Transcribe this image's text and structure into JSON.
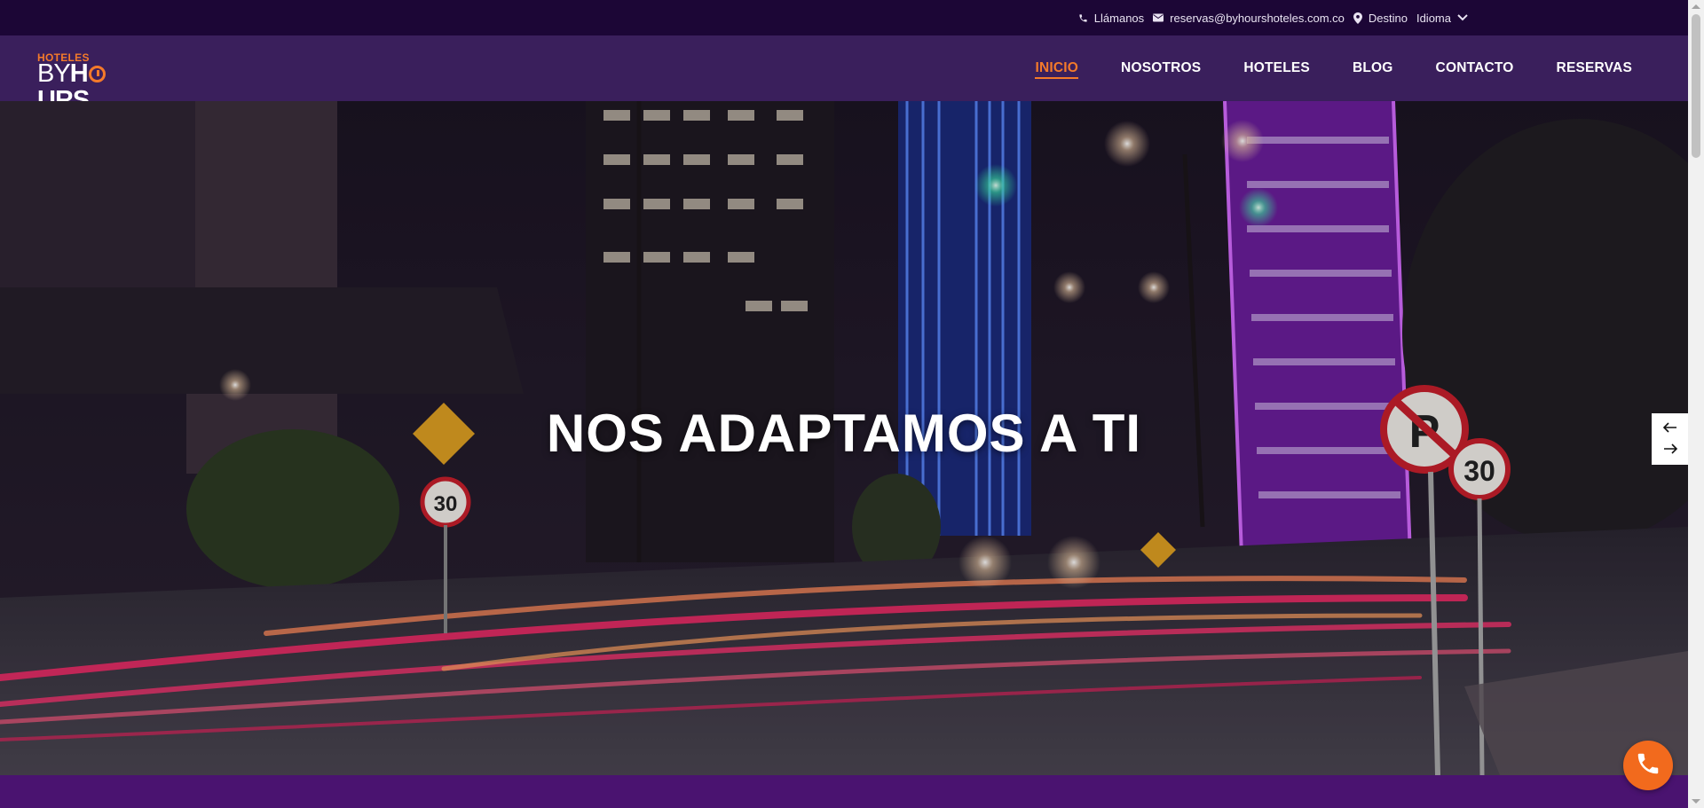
{
  "topbar": {
    "phone_label": "Llámanos",
    "email_label": "reservas@byhourshoteles.com.co",
    "destination_label": "Destino",
    "language_label": "Idioma"
  },
  "logo": {
    "top_text": "HOTELES",
    "by_text": "BY",
    "h_text": "H",
    "urs_text": "URS"
  },
  "nav": {
    "items": [
      {
        "label": "INICIO",
        "active": true
      },
      {
        "label": "NOSOTROS",
        "active": false
      },
      {
        "label": "HOTELES",
        "active": false
      },
      {
        "label": "BLOG",
        "active": false
      },
      {
        "label": "CONTACTO",
        "active": false
      },
      {
        "label": "RESERVAS",
        "active": false
      }
    ]
  },
  "hero": {
    "title": "NOS ADAPTAMOS A TI"
  },
  "colors": {
    "accent": "#f47a2a",
    "topbar_bg": "#1c0636",
    "header_bg": "#3a1f5c",
    "band_bg": "#4a1370"
  },
  "icons": {
    "phone": "phone-icon",
    "email": "envelope-icon",
    "location": "map-pin-icon",
    "chevron": "chevron-down-icon",
    "prev": "arrow-left-icon",
    "next": "arrow-right-icon",
    "whatsapp": "phone-call-icon"
  }
}
